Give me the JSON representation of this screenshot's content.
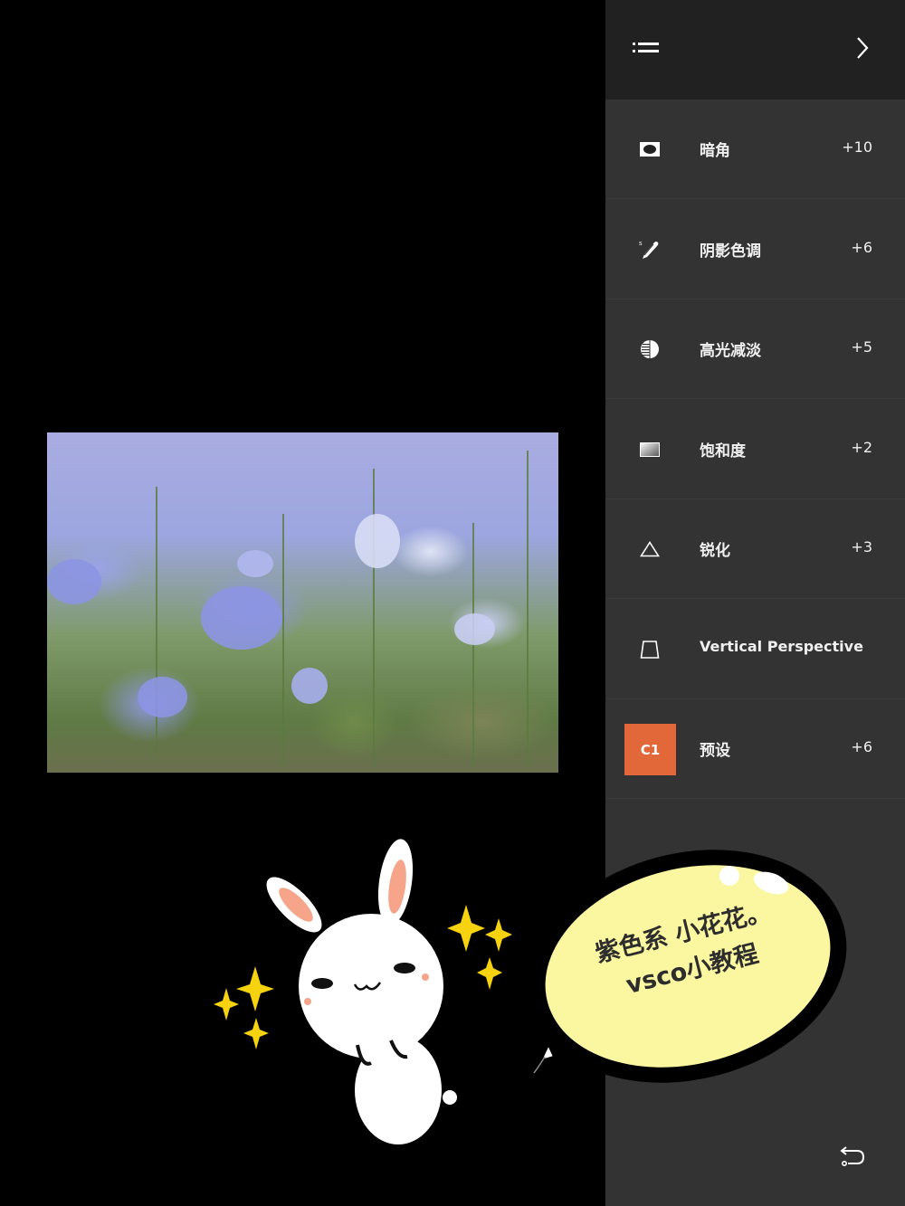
{
  "header": {
    "menu_icon": "list-icon",
    "next_icon": "chevron-right-icon"
  },
  "tools": [
    {
      "icon": "vignette-icon",
      "label": "暗角",
      "value": "+10"
    },
    {
      "icon": "shadow-tint-icon",
      "label": "阴影色调",
      "value": "+6"
    },
    {
      "icon": "highlight-fade-icon",
      "label": "高光减淡",
      "value": "+5"
    },
    {
      "icon": "saturation-icon",
      "label": "饱和度",
      "value": "+2"
    },
    {
      "icon": "sharpen-icon",
      "label": "锐化",
      "value": "+3"
    },
    {
      "icon": "vertical-perspective-icon",
      "label": "Vertical Perspective",
      "value": ""
    },
    {
      "icon": "preset-badge",
      "badge": "C1",
      "label": "预设",
      "value": "+6"
    }
  ],
  "footer": {
    "undo_icon": "undo-icon"
  },
  "sticker": {
    "bubble_line1": "紫色系 小花花。",
    "bubble_line2": "vsco小教程"
  },
  "colors": {
    "panel_bg": "#333333",
    "header_bg": "#212121",
    "preset_accent": "#e2683a",
    "bubble_fill": "#fbf6a0"
  }
}
